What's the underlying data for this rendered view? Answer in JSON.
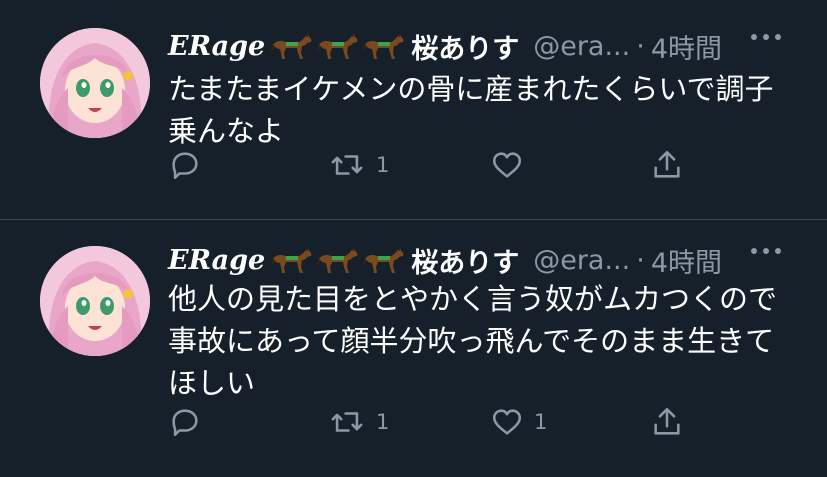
{
  "tweets": [
    {
      "name": "ERage",
      "name_suffix": "桜ありす",
      "handle": "@era...",
      "separator": "·",
      "time": "4時間",
      "text": "たまたまイケメンの骨に産まれたくらいで調子乗んなよ",
      "retweets": "1",
      "likes": ""
    },
    {
      "name": "ERage",
      "name_suffix": "桜ありす",
      "handle": "@era...",
      "separator": "·",
      "time": "4時間",
      "text": "他人の見た目をとやかく言う奴がムカつくので事故にあって顔半分吹っ飛んでそのまま生きてほしい",
      "retweets": "1",
      "likes": "1"
    }
  ],
  "colors": {
    "background": "#15202b",
    "secondary_text": "#8b98a5",
    "divider": "#38444d"
  },
  "icons": [
    "horse-emoji",
    "reply-icon",
    "retweet-icon",
    "like-icon",
    "share-icon",
    "more-icon"
  ]
}
